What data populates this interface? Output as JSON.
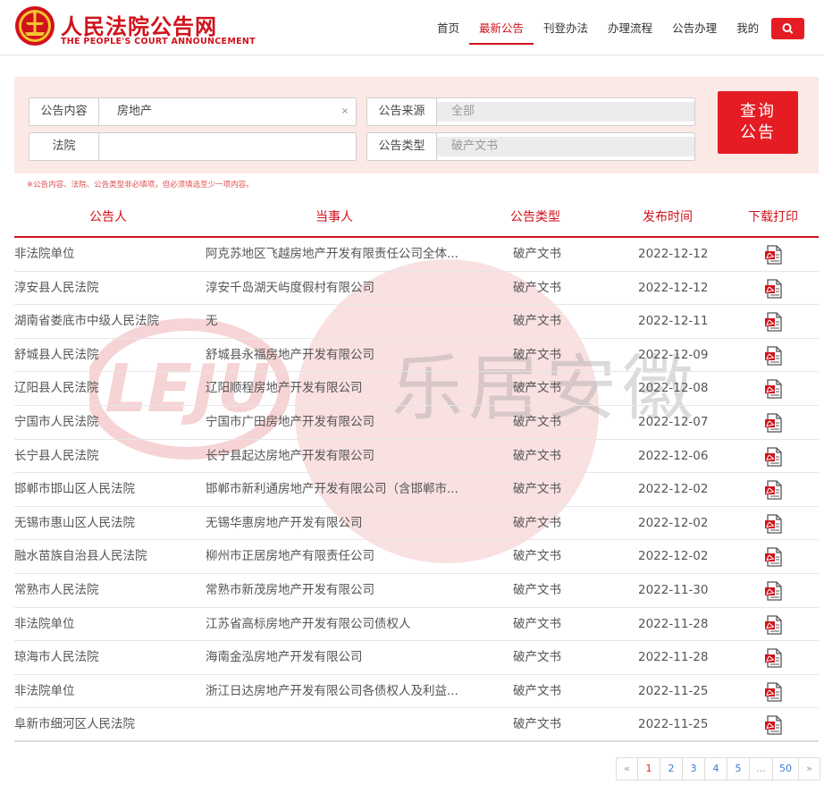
{
  "site": {
    "title_cn": "人民法院公告网",
    "title_en": "THE PEOPLE'S COURT ANNOUNCEMENT"
  },
  "nav": {
    "items": [
      {
        "label": "首页",
        "active": false
      },
      {
        "label": "最新公告",
        "active": true
      },
      {
        "label": "刊登办法",
        "active": false
      },
      {
        "label": "办理流程",
        "active": false
      },
      {
        "label": "公告办理",
        "active": false
      },
      {
        "label": "我的",
        "active": false
      }
    ]
  },
  "search": {
    "content_label": "公告内容",
    "content_value": "房地产",
    "clear_symbol": "×",
    "court_label": "法院",
    "court_value": "",
    "source_label": "公告来源",
    "source_value": "全部",
    "type_label": "公告类型",
    "type_value": "破产文书",
    "query_line1": "查询",
    "query_line2": "公告",
    "hint": "※公告内容、法院、公告类型非必填项，但必须填选至少一项内容。"
  },
  "table": {
    "headers": [
      "公告人",
      "当事人",
      "公告类型",
      "发布时间",
      "下载打印"
    ],
    "rows": [
      {
        "announcer": "非法院单位",
        "party": "阿克苏地区飞越房地产开发有限责任公司全体...",
        "type": "破产文书",
        "date": "2022-12-12"
      },
      {
        "announcer": "淳安县人民法院",
        "party": "淳安千岛湖天屿度假村有限公司",
        "type": "破产文书",
        "date": "2022-12-12"
      },
      {
        "announcer": "湖南省娄底市中级人民法院",
        "party": "无",
        "type": "破产文书",
        "date": "2022-12-11"
      },
      {
        "announcer": "舒城县人民法院",
        "party": "舒城县永福房地产开发有限公司",
        "type": "破产文书",
        "date": "2022-12-09"
      },
      {
        "announcer": "辽阳县人民法院",
        "party": "辽阳顺程房地产开发有限公司",
        "type": "破产文书",
        "date": "2022-12-08"
      },
      {
        "announcer": "宁国市人民法院",
        "party": "宁国市广田房地产开发有限公司",
        "type": "破产文书",
        "date": "2022-12-07"
      },
      {
        "announcer": "长宁县人民法院",
        "party": "长宁县起达房地产开发有限公司",
        "type": "破产文书",
        "date": "2022-12-06"
      },
      {
        "announcer": "邯郸市邯山区人民法院",
        "party": "邯郸市新利通房地产开发有限公司（含邯郸市...",
        "type": "破产文书",
        "date": "2022-12-02"
      },
      {
        "announcer": "无锡市惠山区人民法院",
        "party": "无锡华惠房地产开发有限公司",
        "type": "破产文书",
        "date": "2022-12-02"
      },
      {
        "announcer": "融水苗族自治县人民法院",
        "party": "柳州市正居房地产有限责任公司",
        "type": "破产文书",
        "date": "2022-12-02"
      },
      {
        "announcer": "常熟市人民法院",
        "party": "常熟市新茂房地产开发有限公司",
        "type": "破产文书",
        "date": "2022-11-30"
      },
      {
        "announcer": "非法院单位",
        "party": "江苏省高标房地产开发有限公司债权人",
        "type": "破产文书",
        "date": "2022-11-28"
      },
      {
        "announcer": "琼海市人民法院",
        "party": "海南金泓房地产开发有限公司",
        "type": "破产文书",
        "date": "2022-11-28"
      },
      {
        "announcer": "非法院单位",
        "party": "浙江日达房地产开发有限公司各债权人及利益...",
        "type": "破产文书",
        "date": "2022-11-25"
      },
      {
        "announcer": "阜新市细河区人民法院",
        "party": "",
        "type": "破产文书",
        "date": "2022-11-25"
      }
    ]
  },
  "watermark": {
    "logo_text": "LEJU",
    "text": "乐居安徽"
  },
  "pagination": {
    "items": [
      {
        "label": "«",
        "kind": "prev"
      },
      {
        "label": "1",
        "kind": "current"
      },
      {
        "label": "2",
        "kind": "page"
      },
      {
        "label": "3",
        "kind": "page"
      },
      {
        "label": "4",
        "kind": "page"
      },
      {
        "label": "5",
        "kind": "page"
      },
      {
        "label": "...",
        "kind": "ellipsis"
      },
      {
        "label": "50",
        "kind": "page"
      },
      {
        "label": "»",
        "kind": "next"
      }
    ]
  },
  "colors": {
    "brand_red": "#d0121b",
    "button_red": "#e51c23",
    "panel_bg": "#fbe9e6"
  }
}
